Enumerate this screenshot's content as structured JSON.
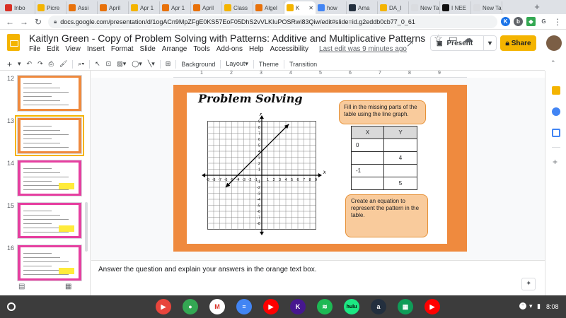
{
  "browser": {
    "tabs": [
      {
        "label": "Inbo",
        "color": "#d93025"
      },
      {
        "label": "Picre",
        "color": "#f4b400"
      },
      {
        "label": "Assi",
        "color": "#e8710a"
      },
      {
        "label": "April",
        "color": "#e8710a"
      },
      {
        "label": "Apr 1",
        "color": "#f4b400"
      },
      {
        "label": "Apr 1",
        "color": "#e8710a"
      },
      {
        "label": "April",
        "color": "#e8710a"
      },
      {
        "label": "Class",
        "color": "#f4b400"
      },
      {
        "label": "Algel",
        "color": "#e8710a"
      },
      {
        "label": "K",
        "color": "#f4b400"
      },
      {
        "label": "how",
        "color": "#4285f4"
      },
      {
        "label": "Ama",
        "color": "#232f3e"
      },
      {
        "label": "DA_l",
        "color": "#f4b400"
      },
      {
        "label": "New Tab",
        "color": "#dadce0"
      },
      {
        "label": "I NEE",
        "color": "#111111"
      },
      {
        "label": "New Tab",
        "color": "#dadce0"
      }
    ],
    "url": "docs.google.com/presentation/d/1ogACn9MpZFgE0KS57EoF05DhS2vVLKIuPOSRwi83Qiw/edit#slide=id.g2eddb0cb77_0_61"
  },
  "doc": {
    "title": "Kaitlyn Green - Copy of Problem Solving with Patterns: Additive and Multiplicative Patterns",
    "menus": [
      "File",
      "Edit",
      "View",
      "Insert",
      "Format",
      "Slide",
      "Arrange",
      "Tools",
      "Add-ons",
      "Help",
      "Accessibility"
    ],
    "last_edit": "Last edit was 9 minutes ago",
    "present_label": "Present",
    "share_label": "Share"
  },
  "toolbar": {
    "background": "Background",
    "layout": "Layout",
    "theme": "Theme",
    "transition": "Transition"
  },
  "ruler": [
    "1",
    "2",
    "3",
    "4",
    "5",
    "6",
    "7",
    "8",
    "9"
  ],
  "filmstrip": {
    "slides": [
      {
        "num": "12",
        "border": "#ef8a3e"
      },
      {
        "num": "13",
        "border": "#ef8a3e",
        "selected": true
      },
      {
        "num": "14",
        "border": "#e63fa0"
      },
      {
        "num": "15",
        "border": "#e63fa0"
      },
      {
        "num": "16",
        "border": "#e63fa0"
      }
    ]
  },
  "slide": {
    "title": "Problem Solving",
    "fill_prompt": "Fill in the missing parts of the table using the line graph.",
    "equation_prompt": "Create an equation to represent the pattern in the table.",
    "table": {
      "headers": [
        "X",
        "Y"
      ],
      "rows": [
        [
          "0",
          ""
        ],
        [
          "",
          "4"
        ],
        [
          "-1",
          ""
        ],
        [
          "",
          "5"
        ]
      ]
    },
    "graph": {
      "x_label": "x",
      "y_label": "y",
      "x_ticks": [
        "-9",
        "-8",
        "-7",
        "-6",
        "-5",
        "-4",
        "-3",
        "-2",
        "-1",
        "1",
        "2",
        "3",
        "4",
        "5",
        "6",
        "7",
        "8",
        "9"
      ],
      "y_ticks": [
        "9",
        "8",
        "7",
        "6",
        "5",
        "4",
        "3",
        "2",
        "1",
        "-1",
        "-2",
        "-3",
        "-4",
        "-5",
        "-6",
        "-7",
        "-8"
      ]
    }
  },
  "notes": "Answer the question and explain your answers in the orange text box.",
  "shelf": {
    "apps": [
      {
        "name": "screencastify",
        "color": "#e8453c",
        "glyph": "▶"
      },
      {
        "name": "chrome",
        "color": "#34a853",
        "glyph": "●"
      },
      {
        "name": "gmail",
        "color": "#ffffff",
        "glyph": "M"
      },
      {
        "name": "docs",
        "color": "#4285f4",
        "glyph": "≡"
      },
      {
        "name": "youtube",
        "color": "#ff0000",
        "glyph": "▶"
      },
      {
        "name": "kahoot",
        "color": "#46178f",
        "glyph": "K"
      },
      {
        "name": "spotify",
        "color": "#1db954",
        "glyph": "≋"
      },
      {
        "name": "hulu",
        "color": "#1ce783",
        "glyph": "hulu"
      },
      {
        "name": "amazon",
        "color": "#232f3e",
        "glyph": "a"
      },
      {
        "name": "classroom",
        "color": "#0f9d58",
        "glyph": "▦"
      },
      {
        "name": "youtube-music",
        "color": "#ff0000",
        "glyph": "▶"
      }
    ],
    "time": "8:08"
  }
}
